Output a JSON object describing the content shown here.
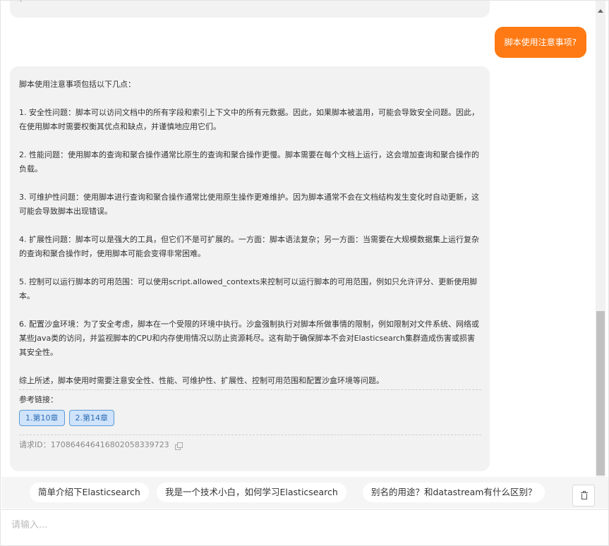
{
  "chat": {
    "user_message": "脚本使用注意事项?",
    "answer": {
      "intro": "脚本使用注意事项包括以下几点：",
      "paragraphs": [
        "1. 安全性问题：脚本可以访问文档中的所有字段和索引上下文中的所有元数据。因此，如果脚本被滥用，可能会导致安全问题。因此，在使用脚本时需要权衡其优点和缺点，并谨慎地应用它们。",
        "2. 性能问题：使用脚本的查询和聚合操作通常比原生的查询和聚合操作更慢。脚本需要在每个文档上运行，这会增加查询和聚合操作的负载。",
        "3. 可维护性问题：使用脚本进行查询和聚合操作通常比使用原生操作更难维护。因为脚本通常不会在文档结构发生变化时自动更新，这可能会导致脚本出现错误。",
        "4. 扩展性问题：脚本可以是强大的工具，但它们不是可扩展的。一方面：脚本语法复杂；另一方面：当需要在大规模数据集上运行复杂的查询和聚合操作时，使用脚本可能会变得非常困难。",
        "5. 控制可以运行脚本的可用范围：可以使用script.allowed_contexts来控制可以运行脚本的可用范围，例如只允许评分、更新使用脚本。",
        "6. 配置沙盒环境：为了安全考虑，脚本在一个受限的环境中执行。沙盒强制执行对脚本所做事情的限制，例如限制对文件系统、网络或某些Java类的访问，并监视脚本的CPU和内存使用情况以防止资源耗尽。这有助于确保脚本不会对Elasticsearch集群造成伤害或损害其安全性。"
      ],
      "summary": "综上所述，脚本使用时需要注意安全性、性能、可维护性、扩展性、控制可用范围和配置沙盒环境等问题。",
      "refs_label": "参考链接：",
      "refs": [
        "1.第10章",
        "2.第14章"
      ],
      "request_id": "请求ID：17086464641680205833972​3"
    }
  },
  "suggestions": [
    "简单介绍下Elasticsearch",
    "我是一个技术小白，如何学习Elasticsearch",
    "别名的用途？和datastream有什么区别？"
  ],
  "input": {
    "placeholder": "请输入..."
  },
  "colors": {
    "accent": "#ff7a14",
    "chip_border": "#5b9bd5",
    "chip_bg": "#cfe3fb"
  }
}
